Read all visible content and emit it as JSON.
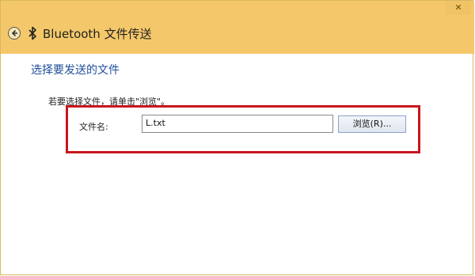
{
  "window": {
    "title": "Bluetooth 文件传送",
    "close_glyph": "✕",
    "back_icon": "back-arrow-icon",
    "bluetooth_icon": "bluetooth-icon"
  },
  "main": {
    "heading": "选择要发送的文件",
    "instruction": "若要选择文件，请单击\"浏览\"。",
    "file_label": "文件名:",
    "file_value": "L.txt",
    "browse_label": "浏览(R)..."
  },
  "colors": {
    "title_bar": "#f4c86a",
    "heading": "#1f4e9c",
    "highlight": "#c8161d"
  }
}
